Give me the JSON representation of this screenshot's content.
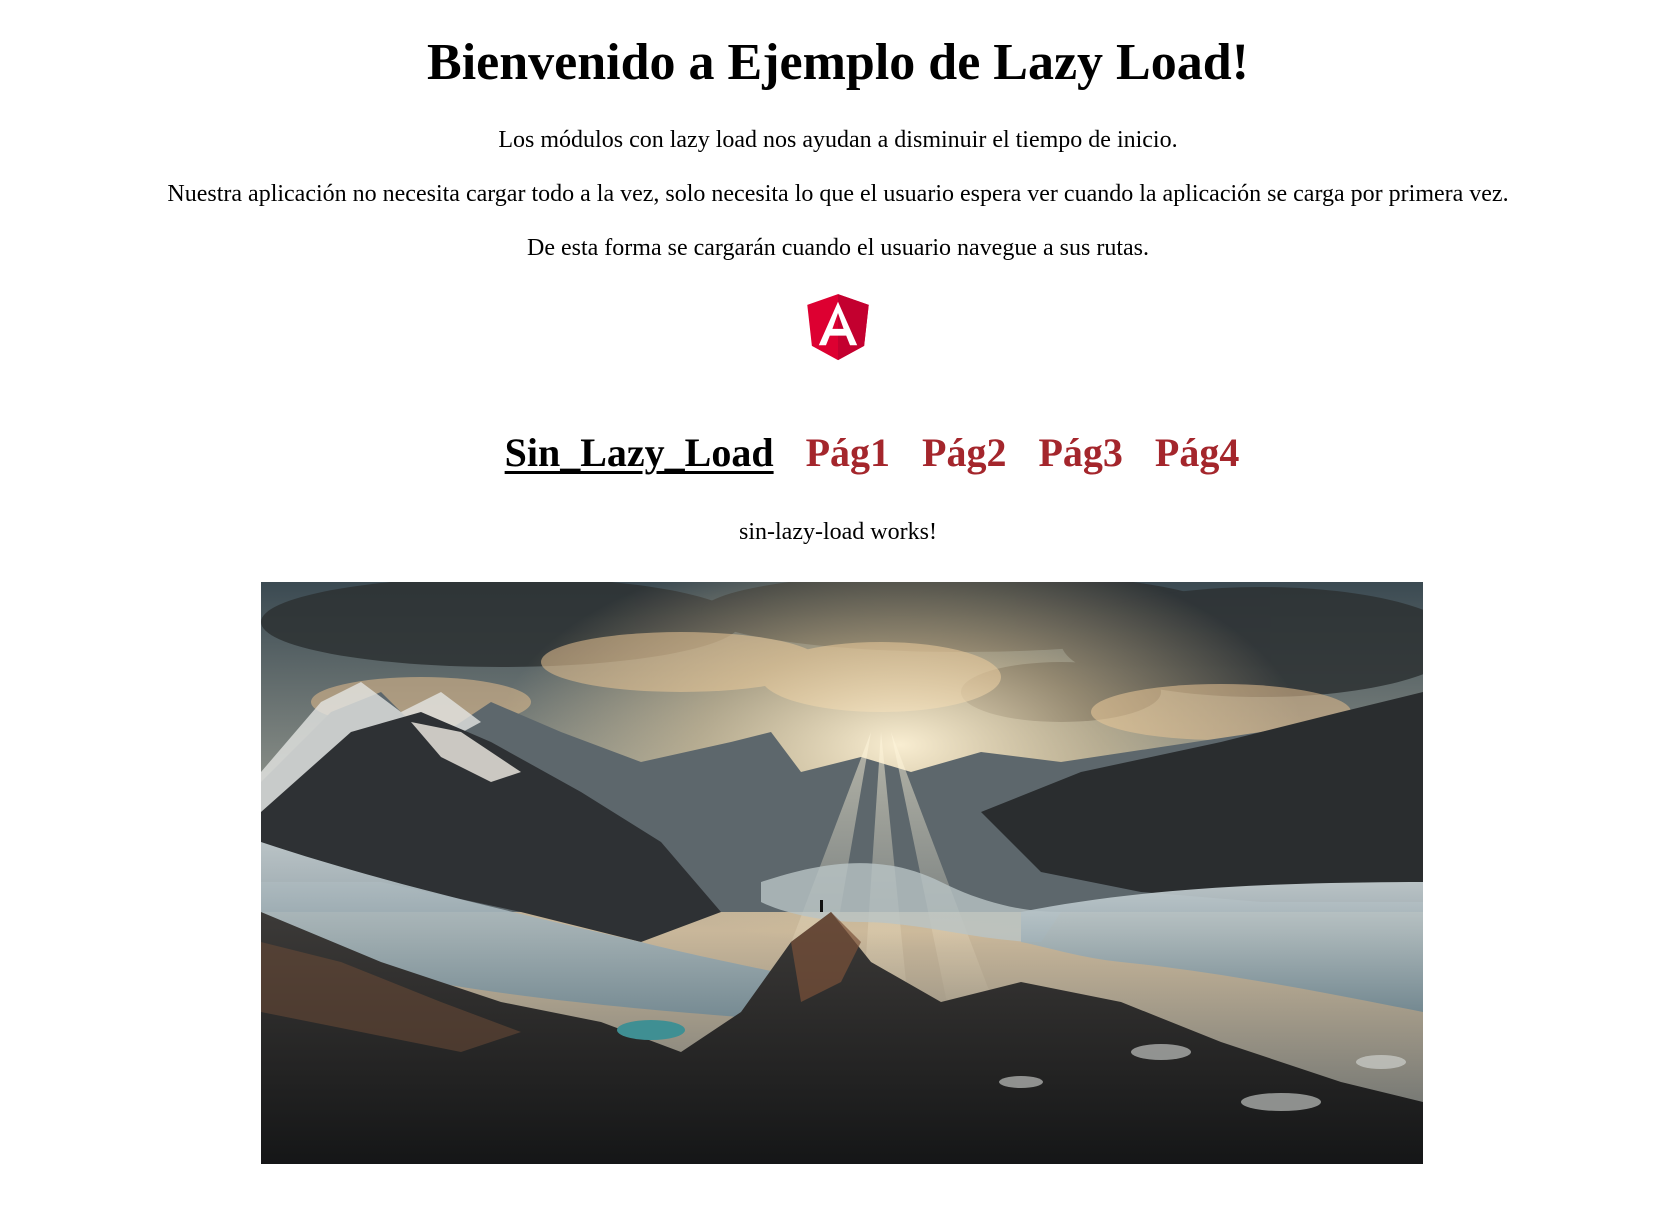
{
  "header": {
    "title": "Bienvenido a Ejemplo de Lazy Load!"
  },
  "intro": {
    "line1": "Los módulos con lazy load nos ayudan a disminuir el tiempo de inicio.",
    "line2": "Nuestra aplicación no necesita cargar todo a la vez, solo necesita lo que el usuario espera ver cuando la aplicación se carga por primera vez.",
    "line3": "De esta forma se cargarán cuando el usuario navegue a sus rutas."
  },
  "logo": {
    "icon": "angular-logo-icon",
    "letter": "A",
    "color": "#dd0031"
  },
  "nav": {
    "items": [
      {
        "label": "Sin_Lazy_Load",
        "active": true
      },
      {
        "label": "Pág1",
        "active": false
      },
      {
        "label": "Pág2",
        "active": false
      },
      {
        "label": "Pág3",
        "active": false
      },
      {
        "label": "Pág4",
        "active": false
      }
    ],
    "active_color": "#000000",
    "link_color": "#a4262c"
  },
  "content": {
    "status_text": "sin-lazy-load works!",
    "image": "mountain-landscape-photo"
  }
}
